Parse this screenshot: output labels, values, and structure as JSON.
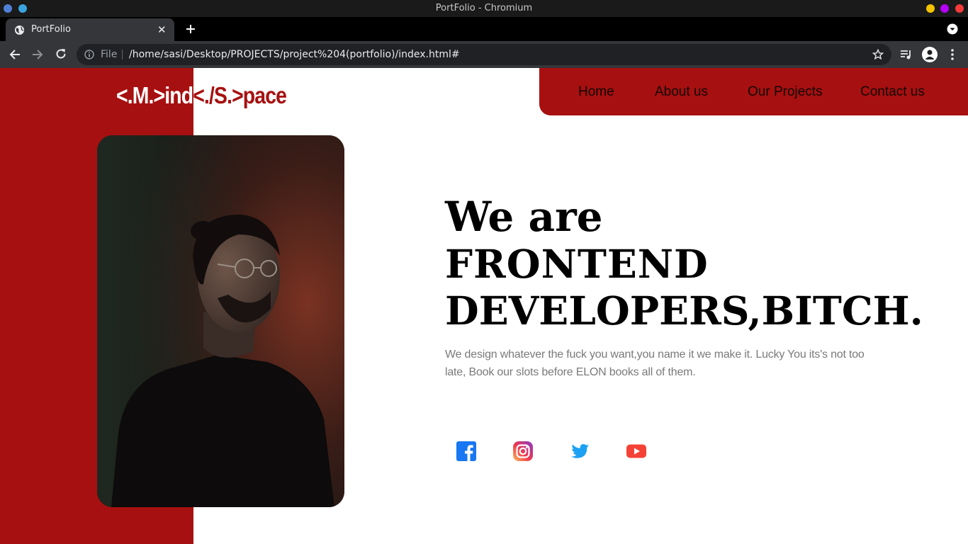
{
  "window": {
    "title": "PortFolio - Chromium"
  },
  "tab": {
    "title": "PortFolio",
    "close": "✕"
  },
  "toolbar": {
    "file_label": "File",
    "url": "/home/sasi/Desktop/PROJECTS/project%204(portfolio)/index.html#"
  },
  "logo": {
    "part_a": "<.M.>ind",
    "part_b": "<./S.>pace"
  },
  "nav": [
    {
      "label": "Home"
    },
    {
      "label": "About us"
    },
    {
      "label": "Our Projects"
    },
    {
      "label": "Contact us"
    }
  ],
  "hero": {
    "line1": "We are",
    "line2": "FRONTEND",
    "line3": "DEVELOPERS,BITCH.",
    "description": "We design whatever the fuck you want,you name it we make it. Lucky You its's not too late, Book our slots before ELON books all of them."
  },
  "social": [
    {
      "icon": "facebook-icon"
    },
    {
      "icon": "instagram-icon"
    },
    {
      "icon": "twitter-icon"
    },
    {
      "icon": "youtube-icon"
    }
  ],
  "colors": {
    "accent": "#a71010",
    "window_dots": [
      "#f5c400",
      "#b400f5",
      "#f53a3a"
    ]
  }
}
